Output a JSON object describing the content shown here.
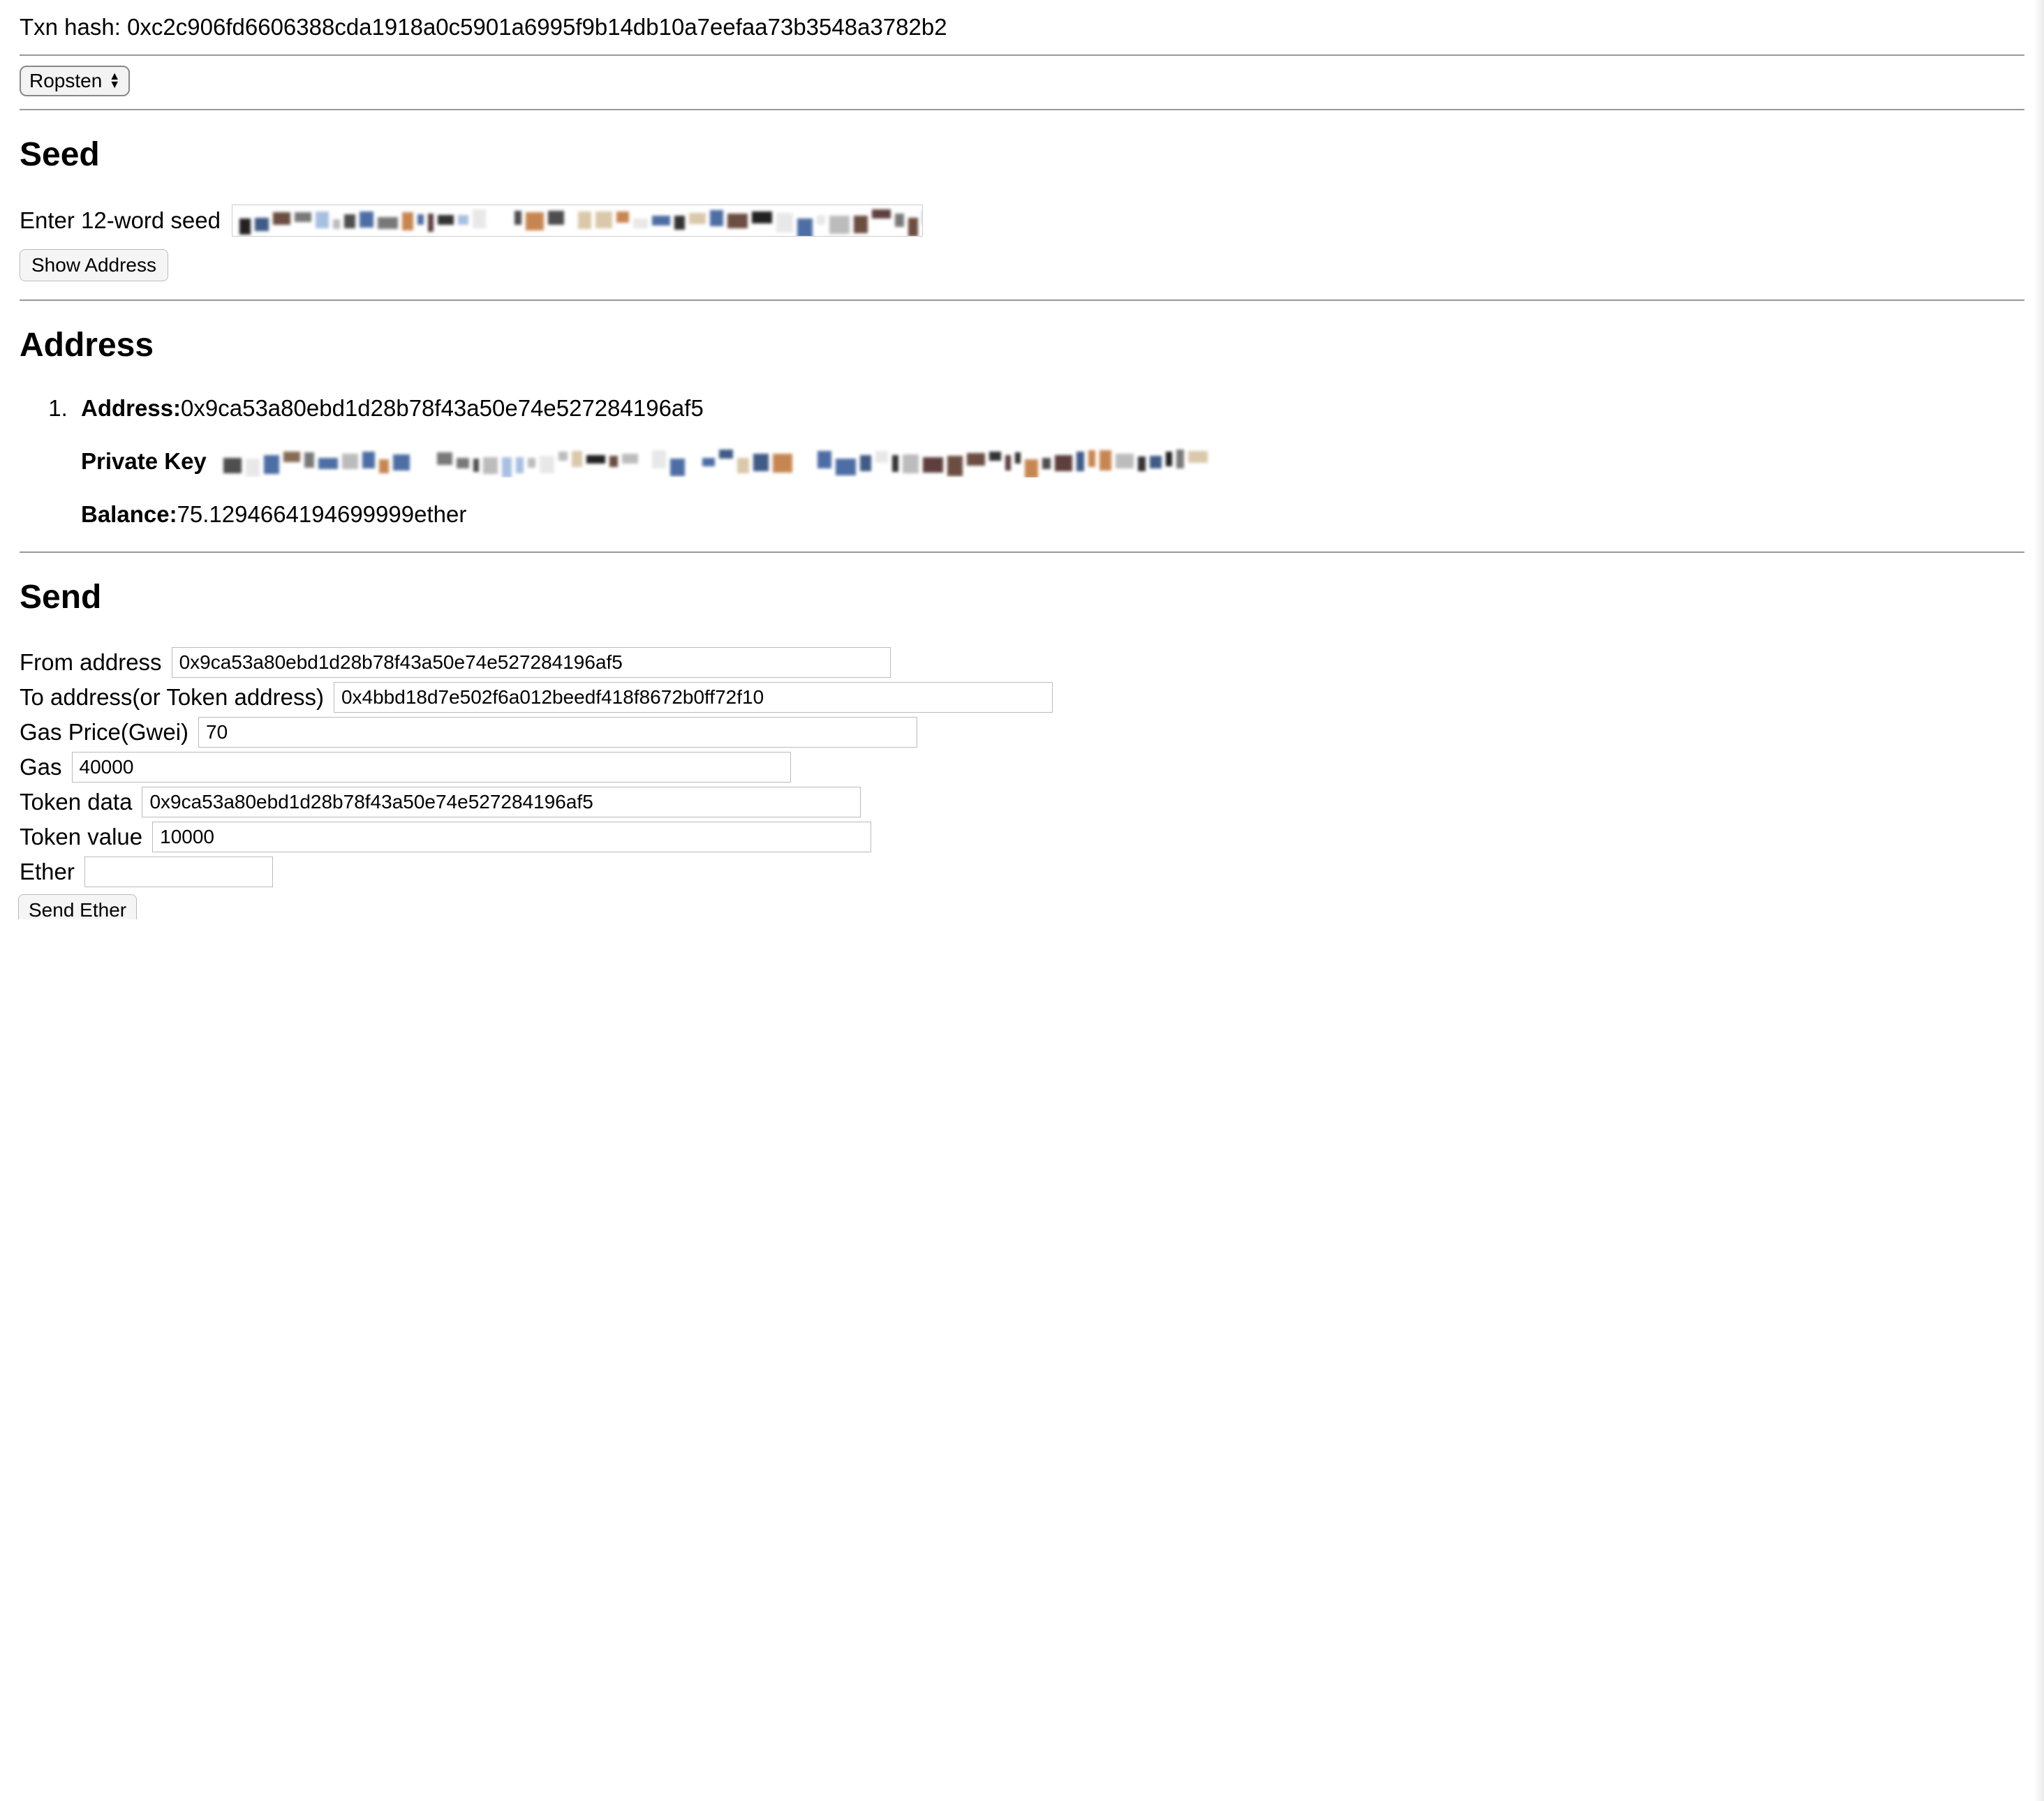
{
  "txn": {
    "label": "Txn hash: ",
    "value": "0xc2c906fd6606388cda1918a0c5901a6995f9b14db10a7eefaa73b3548a3782b2"
  },
  "network": {
    "selected": "Ropsten"
  },
  "seed": {
    "heading": "Seed",
    "inputLabel": "Enter 12-word seed",
    "inputValue": "",
    "showButton": "Show Address"
  },
  "address": {
    "heading": "Address",
    "items": [
      {
        "addressLabel": "Address:",
        "addressValue": "0x9ca53a80ebd1d28b78f43a50e74e527284196af5",
        "privateKeyLabel": "Private Key",
        "balanceLabel": "Balance:",
        "balanceValue": "75.1294664194699999",
        "balanceUnit": "ether"
      }
    ]
  },
  "send": {
    "heading": "Send",
    "fromLabel": "From address",
    "fromValue": "0x9ca53a80ebd1d28b78f43a50e74e527284196af5",
    "toLabel": "To address(or Token address)",
    "toValue": "0x4bbd18d7e502f6a012beedf418f8672b0ff72f10",
    "gasPriceLabel": "Gas Price(Gwei)",
    "gasPriceValue": "70",
    "gasLabel": "Gas",
    "gasValue": "40000",
    "tokenDataLabel": "Token data",
    "tokenDataValue": "0x9ca53a80ebd1d28b78f43a50e74e527284196af5",
    "tokenValueLabel": "Token value",
    "tokenValueValue": "10000",
    "etherLabel": "Ether",
    "etherValue": "",
    "sendButton": "Send Ether"
  }
}
